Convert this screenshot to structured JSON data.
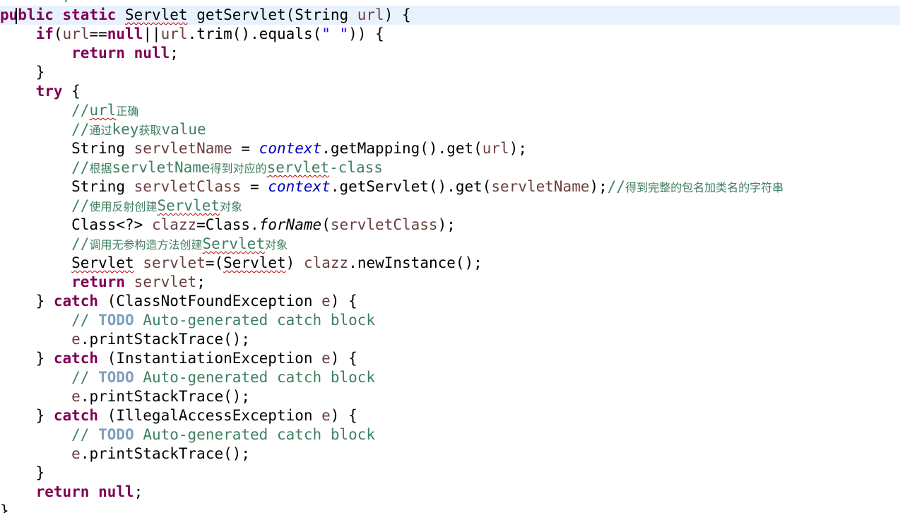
{
  "editor": {
    "partial_top_text": "*/",
    "lines": [
      {
        "current": true,
        "tokens": [
          {
            "t": "public",
            "c": "kw"
          },
          {
            "t": " "
          },
          {
            "t": "static",
            "c": "kw"
          },
          {
            "t": " "
          },
          {
            "t": "Servlet",
            "c": "err"
          },
          {
            "t": " getServlet(String "
          },
          {
            "t": "url",
            "c": "loc"
          },
          {
            "t": ") {"
          }
        ]
      },
      {
        "tokens": [
          {
            "t": "    "
          },
          {
            "t": "if",
            "c": "kw"
          },
          {
            "t": "("
          },
          {
            "t": "url",
            "c": "loc"
          },
          {
            "t": "=="
          },
          {
            "t": "null",
            "c": "kw"
          },
          {
            "t": "||"
          },
          {
            "t": "url",
            "c": "loc"
          },
          {
            "t": ".trim().equals("
          },
          {
            "t": "\" \"",
            "c": "str"
          },
          {
            "t": ")) {"
          }
        ]
      },
      {
        "tokens": [
          {
            "t": "        "
          },
          {
            "t": "return",
            "c": "kw"
          },
          {
            "t": " "
          },
          {
            "t": "null",
            "c": "kw"
          },
          {
            "t": ";"
          }
        ]
      },
      {
        "tokens": [
          {
            "t": "    }"
          }
        ]
      },
      {
        "tokens": [
          {
            "t": "    "
          },
          {
            "t": "try",
            "c": "kw"
          },
          {
            "t": " {"
          }
        ]
      },
      {
        "tokens": [
          {
            "t": "        "
          },
          {
            "t": "//",
            "c": "cm"
          },
          {
            "t": "url",
            "c": "cm err"
          },
          {
            "t": "正确",
            "c": "cm cjk"
          }
        ]
      },
      {
        "tokens": [
          {
            "t": "        "
          },
          {
            "t": "//",
            "c": "cm"
          },
          {
            "t": "通过",
            "c": "cm cjk"
          },
          {
            "t": "key",
            "c": "cm"
          },
          {
            "t": "获取",
            "c": "cm cjk"
          },
          {
            "t": "value",
            "c": "cm"
          }
        ]
      },
      {
        "tokens": [
          {
            "t": "        String "
          },
          {
            "t": "servletName",
            "c": "loc"
          },
          {
            "t": " = "
          },
          {
            "t": "context",
            "c": "fld"
          },
          {
            "t": ".getMapping().get("
          },
          {
            "t": "url",
            "c": "loc"
          },
          {
            "t": ");"
          }
        ]
      },
      {
        "tokens": [
          {
            "t": "        "
          },
          {
            "t": "//",
            "c": "cm"
          },
          {
            "t": "根据",
            "c": "cm cjk"
          },
          {
            "t": "servletName",
            "c": "cm"
          },
          {
            "t": "得到对应的",
            "c": "cm cjk"
          },
          {
            "t": "servlet",
            "c": "cm err"
          },
          {
            "t": "-class",
            "c": "cm"
          }
        ]
      },
      {
        "tokens": [
          {
            "t": "        String "
          },
          {
            "t": "servletClass",
            "c": "loc"
          },
          {
            "t": " = "
          },
          {
            "t": "context",
            "c": "fld"
          },
          {
            "t": ".getServlet().get("
          },
          {
            "t": "servletName",
            "c": "loc"
          },
          {
            "t": ");"
          },
          {
            "t": "//",
            "c": "cm"
          },
          {
            "t": "得到完整的包名加类名的字符串",
            "c": "cm cjk"
          }
        ]
      },
      {
        "tokens": [
          {
            "t": "        "
          },
          {
            "t": "//",
            "c": "cm"
          },
          {
            "t": "使用反射创建",
            "c": "cm cjk"
          },
          {
            "t": "Servlet",
            "c": "cm err"
          },
          {
            "t": "对象",
            "c": "cm cjk"
          }
        ]
      },
      {
        "tokens": [
          {
            "t": "        Class<?> "
          },
          {
            "t": "clazz",
            "c": "loc"
          },
          {
            "t": "=Class."
          },
          {
            "t": "forName",
            "c": "sm"
          },
          {
            "t": "("
          },
          {
            "t": "servletClass",
            "c": "loc"
          },
          {
            "t": ");"
          }
        ]
      },
      {
        "tokens": [
          {
            "t": "        "
          },
          {
            "t": "//",
            "c": "cm"
          },
          {
            "t": "调用无参构造方法创建",
            "c": "cm cjk"
          },
          {
            "t": "Servlet",
            "c": "cm err"
          },
          {
            "t": "对象",
            "c": "cm cjk"
          }
        ]
      },
      {
        "tokens": [
          {
            "t": "        "
          },
          {
            "t": "Servlet",
            "c": "err"
          },
          {
            "t": " "
          },
          {
            "t": "servlet",
            "c": "loc"
          },
          {
            "t": "=("
          },
          {
            "t": "Servlet",
            "c": "err"
          },
          {
            "t": ") "
          },
          {
            "t": "clazz",
            "c": "loc"
          },
          {
            "t": ".newInstance();"
          }
        ]
      },
      {
        "tokens": [
          {
            "t": "        "
          },
          {
            "t": "return",
            "c": "kw"
          },
          {
            "t": " "
          },
          {
            "t": "servlet",
            "c": "loc"
          },
          {
            "t": ";"
          }
        ]
      },
      {
        "tokens": [
          {
            "t": "    } "
          },
          {
            "t": "catch",
            "c": "kw"
          },
          {
            "t": " (ClassNotFoundException "
          },
          {
            "t": "e",
            "c": "loc"
          },
          {
            "t": ") {"
          }
        ]
      },
      {
        "tokens": [
          {
            "t": "        "
          },
          {
            "t": "// ",
            "c": "cm"
          },
          {
            "t": "TODO",
            "c": "todo"
          },
          {
            "t": " Auto-generated catch block",
            "c": "cm"
          }
        ]
      },
      {
        "tokens": [
          {
            "t": "        "
          },
          {
            "t": "e",
            "c": "loc"
          },
          {
            "t": ".printStackTrace();"
          }
        ]
      },
      {
        "tokens": [
          {
            "t": "    } "
          },
          {
            "t": "catch",
            "c": "kw"
          },
          {
            "t": " (InstantiationException "
          },
          {
            "t": "e",
            "c": "loc"
          },
          {
            "t": ") {"
          }
        ]
      },
      {
        "tokens": [
          {
            "t": "        "
          },
          {
            "t": "// ",
            "c": "cm"
          },
          {
            "t": "TODO",
            "c": "todo"
          },
          {
            "t": " Auto-generated catch block",
            "c": "cm"
          }
        ]
      },
      {
        "tokens": [
          {
            "t": "        "
          },
          {
            "t": "e",
            "c": "loc"
          },
          {
            "t": ".printStackTrace();"
          }
        ]
      },
      {
        "tokens": [
          {
            "t": "    } "
          },
          {
            "t": "catch",
            "c": "kw"
          },
          {
            "t": " (IllegalAccessException "
          },
          {
            "t": "e",
            "c": "loc"
          },
          {
            "t": ") {"
          }
        ]
      },
      {
        "tokens": [
          {
            "t": "        "
          },
          {
            "t": "// ",
            "c": "cm"
          },
          {
            "t": "TODO",
            "c": "todo"
          },
          {
            "t": " Auto-generated catch block",
            "c": "cm"
          }
        ]
      },
      {
        "tokens": [
          {
            "t": "        "
          },
          {
            "t": "e",
            "c": "loc"
          },
          {
            "t": ".printStackTrace();"
          }
        ]
      },
      {
        "tokens": [
          {
            "t": "    }"
          }
        ]
      },
      {
        "tokens": [
          {
            "t": "    "
          },
          {
            "t": "return",
            "c": "kw"
          },
          {
            "t": " "
          },
          {
            "t": "null",
            "c": "kw"
          },
          {
            "t": ";"
          }
        ]
      },
      {
        "tokens": [
          {
            "t": "}"
          }
        ]
      }
    ]
  },
  "colors": {
    "keyword": "#7f0055",
    "comment": "#3f7f5f",
    "todo": "#7f9fbf",
    "string": "#2a00ff",
    "field": "#0000c0",
    "local_variable": "#6a3e3e",
    "current_line": "#e8f2fe",
    "error_underline": "#c00000"
  }
}
